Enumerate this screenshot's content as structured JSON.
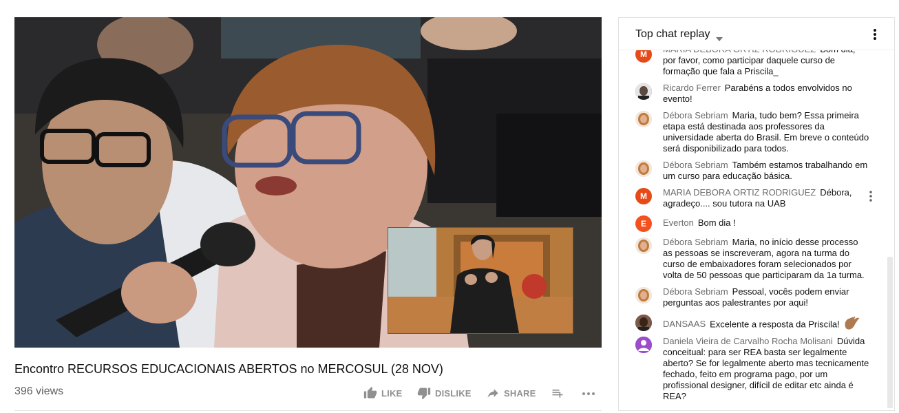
{
  "video": {
    "title": "Encontro RECURSOS EDUCACIONAIS ABERTOS no MERCOSUL (28 NOV)",
    "views": "396 views"
  },
  "actions": {
    "like": "LIKE",
    "dislike": "DISLIKE",
    "share": "SHARE"
  },
  "chat": {
    "title": "Top chat replay",
    "messages": [
      {
        "author": "MARIA DEBORA ORTIZ RODRIGUEZ",
        "text": "Bom dia, por favor, como participar daquele curso de formação que fala a Priscila_",
        "avatar_letter": "M",
        "avatar_color": "#e64a19"
      },
      {
        "author": "Ricardo Ferrer",
        "text": "Parabéns a todos envolvidos no evento!",
        "avatar_color": "#3a3a3a"
      },
      {
        "author": "Débora Sebriam",
        "text": "Maria, tudo bem? Essa primeira etapa está destinada aos professores da universidade aberta do Brasil. Em breve o conteúdo será disponibilizado para todos.",
        "avatar_color": "#c98a5a"
      },
      {
        "author": "Débora Sebriam",
        "text": "Também estamos trabalhando em um curso para educação básica.",
        "avatar_color": "#c98a5a"
      },
      {
        "author": "MARIA DEBORA ORTIZ RODRIGUEZ",
        "text": "Débora, agradeço.... sou tutora na UAB",
        "avatar_letter": "M",
        "avatar_color": "#e64a19"
      },
      {
        "author": "Everton",
        "text": "Bom dia !",
        "avatar_letter": "E",
        "avatar_color": "#f4511e"
      },
      {
        "author": "Débora Sebriam",
        "text": "Maria, no início desse processo as pessoas se inscreveram, agora na turma do curso de embaixadores foram selecionados por volta de 50 pessoas que participaram da 1a turma.",
        "avatar_color": "#c98a5a"
      },
      {
        "author": "Débora Sebriam",
        "text": "Pessoal, vocês podem enviar perguntas aos palestrantes por aqui!",
        "avatar_color": "#c98a5a"
      },
      {
        "author": "DANSAAS",
        "text": "Excelente a resposta da Priscila!",
        "avatar_color": "#5a3a2a"
      },
      {
        "author": "Daniela Vieira de Carvalho Rocha Molisani",
        "text": "Dúvida conceitual: para ser REA basta ser legalmente aberto? Se for legalmente aberto mas tecnicamente fechado, feito em programa pago, por um profissional designer, difícil de editar etc ainda é REA?",
        "avatar_color": "#9c4dcc"
      }
    ]
  }
}
